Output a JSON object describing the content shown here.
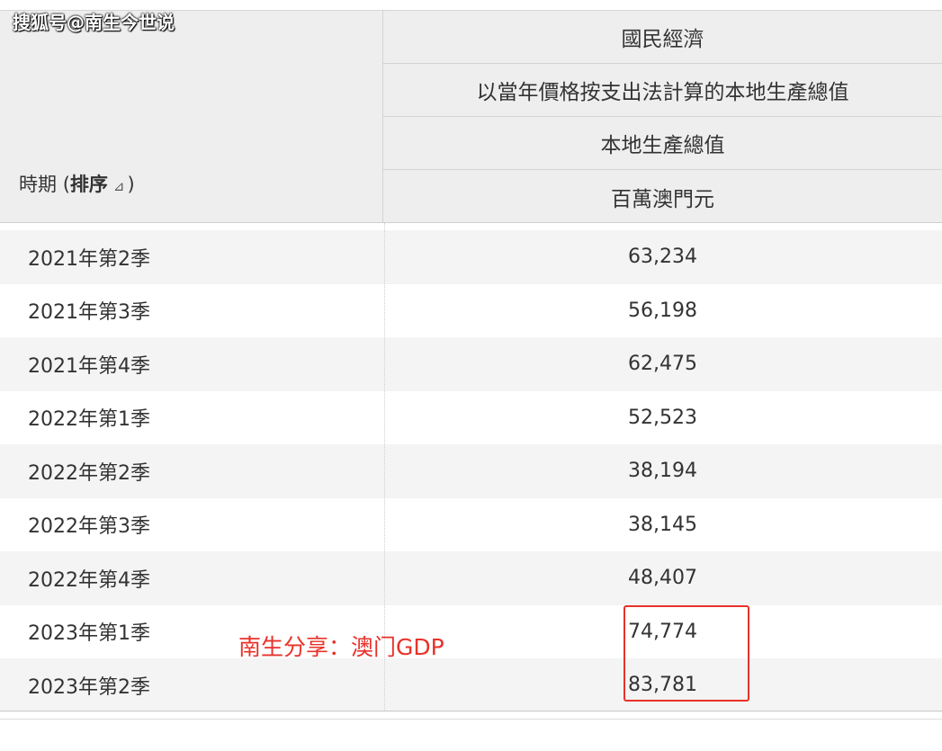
{
  "watermark": "搜狐号@南生今世说",
  "header": {
    "row1": "國民經濟",
    "row2": "以當年價格按支出法計算的本地生產總值",
    "row3": "本地生產總值",
    "row4": "百萬澳門元",
    "period_label": "時期",
    "sort_paren_open": "(",
    "sort_label": "排序",
    "sort_icon": "⊿",
    "sort_paren_close": ")"
  },
  "rows": [
    {
      "period": "2021年第2季",
      "value": "63,234"
    },
    {
      "period": "2021年第3季",
      "value": "56,198"
    },
    {
      "period": "2021年第4季",
      "value": "62,475"
    },
    {
      "period": "2022年第1季",
      "value": "52,523"
    },
    {
      "period": "2022年第2季",
      "value": "38,194"
    },
    {
      "period": "2022年第3季",
      "value": "38,145"
    },
    {
      "period": "2022年第4季",
      "value": "48,407"
    },
    {
      "period": "2023年第1季",
      "value": "74,774"
    },
    {
      "period": "2023年第2季",
      "value": "83,781"
    }
  ],
  "annotation": {
    "text": "南生分享：澳门GDP",
    "color": "#e8322a"
  }
}
